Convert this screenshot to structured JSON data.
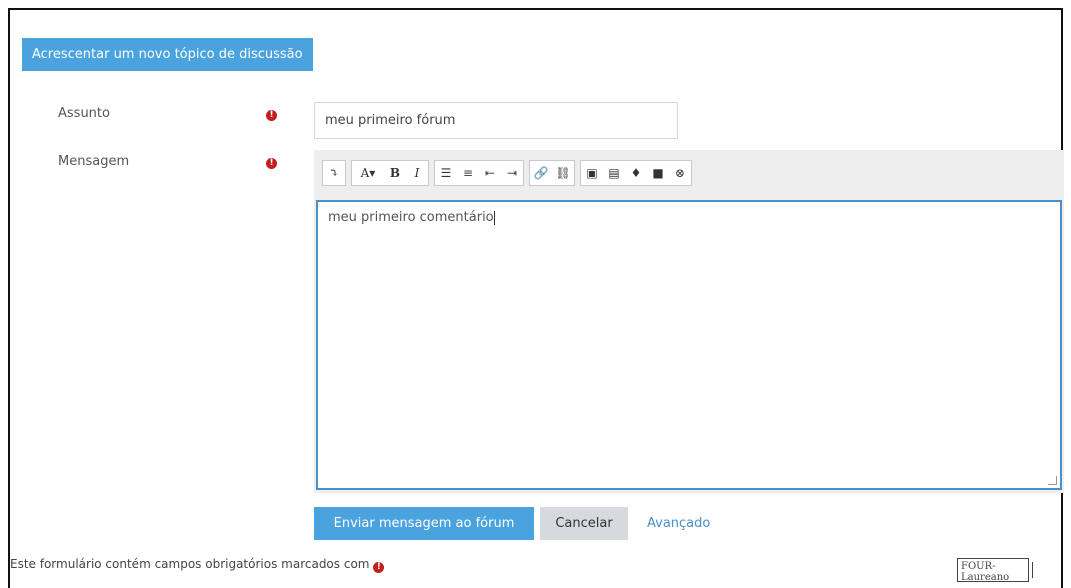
{
  "form": {
    "header_label": "Acrescentar um novo tópico de discussão",
    "subject_label": "Assunto",
    "subject_value": "meu primeiro fórum",
    "message_label": "Mensagem",
    "message_value": "meu primeiro comentário",
    "required_icon": "!"
  },
  "toolbar": {
    "groups": [
      [
        {
          "icon": "collapse-icon",
          "glyph": "⤵"
        }
      ],
      [
        {
          "icon": "font-style-icon",
          "glyph": "A▾"
        },
        {
          "icon": "bold-icon",
          "glyph": "B"
        },
        {
          "icon": "italic-icon",
          "glyph": "I"
        }
      ],
      [
        {
          "icon": "unordered-list-icon",
          "glyph": "☰"
        },
        {
          "icon": "ordered-list-icon",
          "glyph": "≡"
        },
        {
          "icon": "outdent-icon",
          "glyph": "⇤"
        },
        {
          "icon": "indent-icon",
          "glyph": "⇥"
        }
      ],
      [
        {
          "icon": "link-icon",
          "glyph": "🔗"
        },
        {
          "icon": "unlink-icon",
          "glyph": "⛓"
        }
      ],
      [
        {
          "icon": "image-icon",
          "glyph": "▣"
        },
        {
          "icon": "media-icon",
          "glyph": "▤"
        },
        {
          "icon": "microphone-icon",
          "glyph": "♦"
        },
        {
          "icon": "video-icon",
          "glyph": "■"
        },
        {
          "icon": "manage-files-icon",
          "glyph": "⊗"
        }
      ]
    ]
  },
  "actions": {
    "submit_label": "Enviar mensagem ao fórum",
    "cancel_label": "Cancelar",
    "advanced_label": "Avançado"
  },
  "footer": {
    "required_note": "Este formulário contém campos obrigatórios marcados com",
    "tooltip_text": "FOUR-Laureano"
  }
}
